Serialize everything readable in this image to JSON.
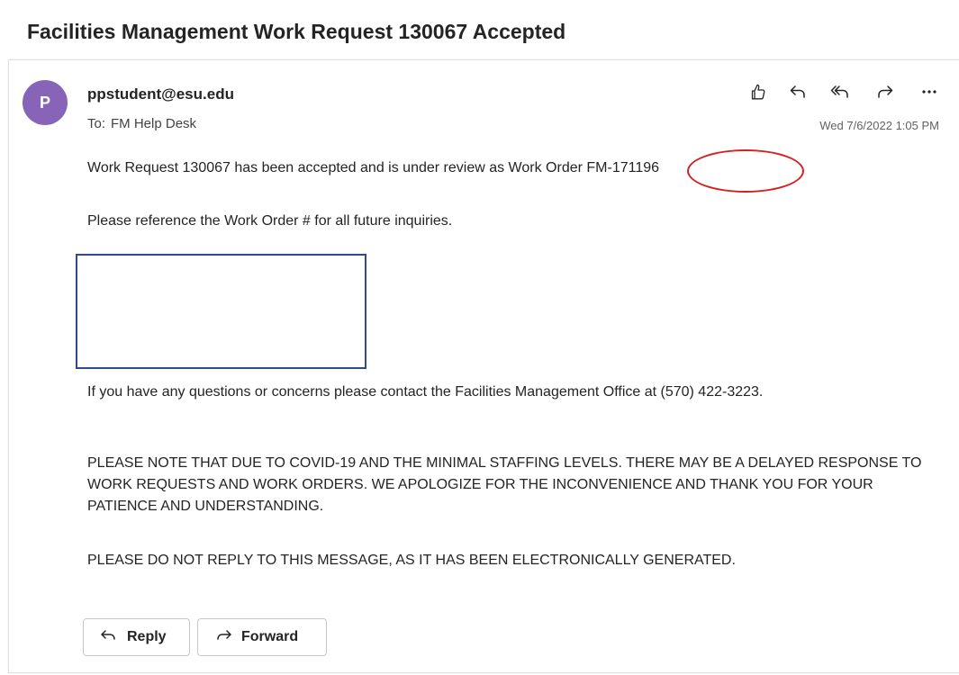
{
  "subject": "Facilities Management Work Request 130067 Accepted",
  "sender": {
    "avatar_initial": "P",
    "email": "ppstudent@esu.edu",
    "to_label": "To:",
    "to_value": "FM Help Desk",
    "date": "Wed 7/6/2022 1:05 PM"
  },
  "actions": {
    "icons": [
      "like-icon",
      "reply-icon",
      "reply-all-icon",
      "forward-icon",
      "more-icon"
    ]
  },
  "body": {
    "line1_prefix": "Work Request 130067 has been accepted and is under review as Work Order ",
    "work_order_number": "FM-171196",
    "line2": "Please reference the Work Order # for all future inquiries.",
    "line3": "If you have any questions or concerns please contact the Facilities Management Office at (570) 422-3223.",
    "line4": "PLEASE NOTE THAT DUE TO COVID-19 AND THE MINIMAL STAFFING LEVELS. THERE MAY BE A DELAYED RESPONSE TO WORK REQUESTS AND WORK ORDERS. WE APOLOGIZE FOR THE INCONVENIENCE AND THANK YOU FOR YOUR PATIENCE AND UNDERSTANDING.",
    "line5": "PLEASE DO NOT REPLY TO THIS MESSAGE, AS IT HAS BEEN ELECTRONICALLY GENERATED."
  },
  "buttons": {
    "reply_label": "Reply",
    "forward_label": "Forward"
  },
  "colors": {
    "avatar_bg": "#8764b8",
    "annotation_circle": "#d61f1f",
    "image_border": "#2f4a8a"
  }
}
